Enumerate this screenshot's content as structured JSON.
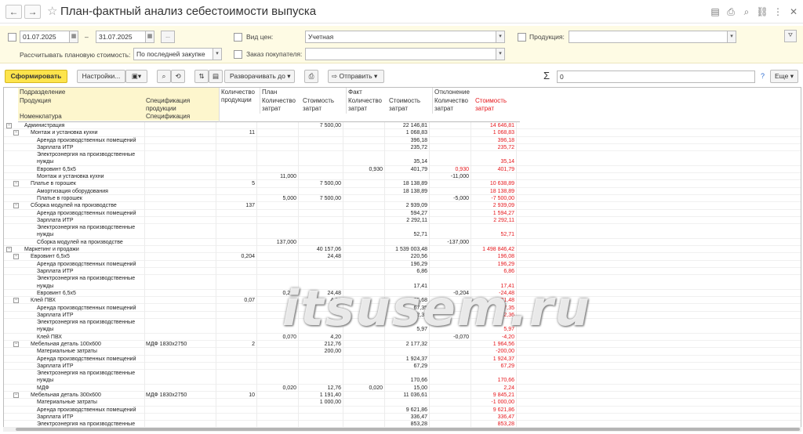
{
  "title": "План-фактный анализ себестоимости выпуска",
  "nav": {
    "back": "←",
    "forward": "→"
  },
  "filter": {
    "date_from": "01.07.2025",
    "date_sep": "–",
    "date_to": "31.07.2025",
    "period_btn": "...",
    "price_type_label": "Вид цен:",
    "price_type_value": "Учетная",
    "product_label": "Продукция:",
    "product_value": "",
    "plan_cost_label": "Рассчитывать плановую стоимость:",
    "plan_cost_value": "По последней закупке",
    "customer_order_label": "Заказ покупателя:",
    "customer_order_value": ""
  },
  "toolbar": {
    "generate": "Сформировать",
    "settings": "Настройки...",
    "expand": "Разворачивать до",
    "send": "Отправить",
    "sum_symbol": "Σ",
    "sum_value": "0",
    "help": "?",
    "more": "Еще"
  },
  "header": {
    "dept": "Подразделение",
    "product": "Продукция",
    "spec": "Спецификация продукции",
    "nomen": "Номенклатура",
    "spec2": "Спецификация",
    "qty_prod": "Количество продукции",
    "plan": "План",
    "fact": "Факт",
    "dev": "Отклонение",
    "qty_cost": "Количество затрат",
    "cost_cost": "Стоимость затрат"
  },
  "rows": [
    {
      "lvl": 0,
      "tog": "⊟",
      "n": "Администрация",
      "spec": "",
      "qp": "",
      "pq": "",
      "pc": "7 500,00",
      "fq": "",
      "fc": "22 146,81",
      "dq": "",
      "dc": "14 646,81"
    },
    {
      "lvl": 1,
      "tog": "⊟",
      "n": "Монтаж и установка кухни",
      "spec": "",
      "qp": "11",
      "pq": "",
      "pc": "",
      "fq": "",
      "fc": "1 068,83",
      "dq": "",
      "dc": "1 068,83"
    },
    {
      "lvl": 2,
      "tog": "",
      "n": "Аренда производственных помещений",
      "spec": "",
      "qp": "",
      "pq": "",
      "pc": "",
      "fq": "",
      "fc": "396,18",
      "dq": "",
      "dc": "396,18"
    },
    {
      "lvl": 2,
      "tog": "",
      "n": "Зарплата ИТР",
      "spec": "",
      "qp": "",
      "pq": "",
      "pc": "",
      "fq": "",
      "fc": "235,72",
      "dq": "",
      "dc": "235,72"
    },
    {
      "lvl": 2,
      "tog": "",
      "n": "Электроэнергия на производственные нужды",
      "spec": "",
      "qp": "",
      "pq": "",
      "pc": "",
      "fq": "",
      "fc": "35,14",
      "dq": "",
      "dc": "35,14",
      "tall": true
    },
    {
      "lvl": 2,
      "tog": "",
      "n": "Евровинт 6,5х5",
      "spec": "",
      "qp": "",
      "pq": "",
      "pc": "",
      "fq": "0,930",
      "fc": "401,79",
      "dq": "0,930",
      "dc": "401,79",
      "dqred": true
    },
    {
      "lvl": 2,
      "tog": "",
      "n": "Монтаж и установка кухни",
      "spec": "",
      "qp": "",
      "pq": "11,000",
      "pc": "",
      "fq": "",
      "fc": "",
      "dq": "-11,000",
      "dc": ""
    },
    {
      "lvl": 1,
      "tog": "⊟",
      "n": "Платье в горошек",
      "spec": "",
      "qp": "5",
      "pq": "",
      "pc": "7 500,00",
      "fq": "",
      "fc": "18 138,89",
      "dq": "",
      "dc": "10 638,89"
    },
    {
      "lvl": 2,
      "tog": "",
      "n": "Амортизация оборудования",
      "spec": "",
      "qp": "",
      "pq": "",
      "pc": "",
      "fq": "",
      "fc": "18 138,89",
      "dq": "",
      "dc": "18 138,89"
    },
    {
      "lvl": 2,
      "tog": "",
      "n": "Платье в горошек",
      "spec": "",
      "qp": "",
      "pq": "5,000",
      "pc": "7 500,00",
      "fq": "",
      "fc": "",
      "dq": "-5,000",
      "dc": "-7 500,00"
    },
    {
      "lvl": 1,
      "tog": "⊟",
      "n": "Сборка модулей на производстве",
      "spec": "",
      "qp": "137",
      "pq": "",
      "pc": "",
      "fq": "",
      "fc": "2 939,09",
      "dq": "",
      "dc": "2 939,09"
    },
    {
      "lvl": 2,
      "tog": "",
      "n": "Аренда производственных помещений",
      "spec": "",
      "qp": "",
      "pq": "",
      "pc": "",
      "fq": "",
      "fc": "594,27",
      "dq": "",
      "dc": "1 594,27"
    },
    {
      "lvl": 2,
      "tog": "",
      "n": "Зарплата ИТР",
      "spec": "",
      "qp": "",
      "pq": "",
      "pc": "",
      "fq": "",
      "fc": "2 292,11",
      "dq": "",
      "dc": "2 292,11"
    },
    {
      "lvl": 2,
      "tog": "",
      "n": "Электроэнергия на производственные нужды",
      "spec": "",
      "qp": "",
      "pq": "",
      "pc": "",
      "fq": "",
      "fc": "52,71",
      "dq": "",
      "dc": "52,71",
      "tall": true
    },
    {
      "lvl": 2,
      "tog": "",
      "n": "Сборка модулей на производстве",
      "spec": "",
      "qp": "",
      "pq": "137,000",
      "pc": "",
      "fq": "",
      "fc": "",
      "dq": "-137,000",
      "dc": ""
    },
    {
      "lvl": 0,
      "tog": "⊟",
      "n": "Маркетинг и продажи",
      "spec": "",
      "qp": "",
      "pq": "",
      "pc": "40 157,06",
      "fq": "",
      "fc": "1 539 003,48",
      "dq": "",
      "dc": "1 498 846,42"
    },
    {
      "lvl": 1,
      "tog": "⊟",
      "n": "Евровинт 6,5х5",
      "spec": "",
      "qp": "0,204",
      "pq": "",
      "pc": "24,48",
      "fq": "",
      "fc": "220,56",
      "dq": "",
      "dc": "196,08"
    },
    {
      "lvl": 2,
      "tog": "",
      "n": "Аренда производственных помещений",
      "spec": "",
      "qp": "",
      "pq": "",
      "pc": "",
      "fq": "",
      "fc": "196,29",
      "dq": "",
      "dc": "196,29"
    },
    {
      "lvl": 2,
      "tog": "",
      "n": "Зарплата ИТР",
      "spec": "",
      "qp": "",
      "pq": "",
      "pc": "",
      "fq": "",
      "fc": "6,86",
      "dq": "",
      "dc": "6,86"
    },
    {
      "lvl": 2,
      "tog": "",
      "n": "Электроэнергия на производственные нужды",
      "spec": "",
      "qp": "",
      "pq": "",
      "pc": "",
      "fq": "",
      "fc": "17,41",
      "dq": "",
      "dc": "17,41",
      "tall": true
    },
    {
      "lvl": 2,
      "tog": "",
      "n": "Евровинт 6,5х5",
      "spec": "",
      "qp": "",
      "pq": "0,204",
      "pc": "24,48",
      "fq": "",
      "fc": "",
      "dq": "-0,204",
      "dc": "-24,48"
    },
    {
      "lvl": 1,
      "tog": "⊟",
      "n": "Клей ПВХ",
      "spec": "",
      "qp": "0,07",
      "pq": "",
      "pc": "4,20",
      "fq": "",
      "fc": "75,68",
      "dq": "",
      "dc": "71,48"
    },
    {
      "lvl": 2,
      "tog": "",
      "n": "Аренда производственных помещений",
      "spec": "",
      "qp": "",
      "pq": "",
      "pc": "",
      "fq": "",
      "fc": "67,35",
      "dq": "",
      "dc": "67,35"
    },
    {
      "lvl": 2,
      "tog": "",
      "n": "Зарплата ИТР",
      "spec": "",
      "qp": "",
      "pq": "",
      "pc": "",
      "fq": "",
      "fc": "2,36",
      "dq": "",
      "dc": "2,36"
    },
    {
      "lvl": 2,
      "tog": "",
      "n": "Электроэнергия на производственные нужды",
      "spec": "",
      "qp": "",
      "pq": "",
      "pc": "",
      "fq": "",
      "fc": "5,97",
      "dq": "",
      "dc": "5,97",
      "tall": true
    },
    {
      "lvl": 2,
      "tog": "",
      "n": "Клей ПВХ",
      "spec": "",
      "qp": "",
      "pq": "0,070",
      "pc": "4,20",
      "fq": "",
      "fc": "",
      "dq": "-0,070",
      "dc": "-4,20"
    },
    {
      "lvl": 1,
      "tog": "⊟",
      "n": "Мебельная деталь 100х600",
      "spec": "МДФ 1830х2750",
      "qp": "2",
      "pq": "",
      "pc": "212,76",
      "fq": "",
      "fc": "2 177,32",
      "dq": "",
      "dc": "1 964,56"
    },
    {
      "lvl": 2,
      "tog": "",
      "n": "Материальные затраты",
      "spec": "",
      "qp": "",
      "pq": "",
      "pc": "200,00",
      "fq": "",
      "fc": "",
      "dq": "",
      "dc": "-200,00"
    },
    {
      "lvl": 2,
      "tog": "",
      "n": "Аренда производственных помещений",
      "spec": "",
      "qp": "",
      "pq": "",
      "pc": "",
      "fq": "",
      "fc": "1 924,37",
      "dq": "",
      "dc": "1 924,37"
    },
    {
      "lvl": 2,
      "tog": "",
      "n": "Зарплата ИТР",
      "spec": "",
      "qp": "",
      "pq": "",
      "pc": "",
      "fq": "",
      "fc": "67,29",
      "dq": "",
      "dc": "67,29"
    },
    {
      "lvl": 2,
      "tog": "",
      "n": "Электроэнергия на производственные нужды",
      "spec": "",
      "qp": "",
      "pq": "",
      "pc": "",
      "fq": "",
      "fc": "170,66",
      "dq": "",
      "dc": "170,66",
      "tall": true
    },
    {
      "lvl": 2,
      "tog": "",
      "n": "МДФ",
      "spec": "",
      "qp": "",
      "pq": "0,020",
      "pc": "12,76",
      "fq": "0,020",
      "fc": "15,00",
      "dq": "",
      "dc": "2,24"
    },
    {
      "lvl": 1,
      "tog": "⊟",
      "n": "Мебельная деталь 300х600",
      "spec": "МДФ 1830х2750",
      "qp": "10",
      "pq": "",
      "pc": "1 191,40",
      "fq": "",
      "fc": "11 036,61",
      "dq": "",
      "dc": "9 845,21"
    },
    {
      "lvl": 2,
      "tog": "",
      "n": "Материальные затраты",
      "spec": "",
      "qp": "",
      "pq": "",
      "pc": "1 000,00",
      "fq": "",
      "fc": "",
      "dq": "",
      "dc": "-1 000,00"
    },
    {
      "lvl": 2,
      "tog": "",
      "n": "Аренда производственных помещений",
      "spec": "",
      "qp": "",
      "pq": "",
      "pc": "",
      "fq": "",
      "fc": "9 621,86",
      "dq": "",
      "dc": "9 621,86"
    },
    {
      "lvl": 2,
      "tog": "",
      "n": "Зарплата ИТР",
      "spec": "",
      "qp": "",
      "pq": "",
      "pc": "",
      "fq": "",
      "fc": "336,47",
      "dq": "",
      "dc": "336,47"
    },
    {
      "lvl": 2,
      "tog": "",
      "n": "Электроэнергия на производственные",
      "spec": "",
      "qp": "",
      "pq": "",
      "pc": "",
      "fq": "",
      "fc": "853,28",
      "dq": "",
      "dc": "853,28"
    }
  ],
  "watermark": "itsusem.ru",
  "colors": {
    "accent": "#fde44c",
    "negative": "#e5161b",
    "header_bg": "#fdf6cd",
    "filter_bg": "#fefbe4"
  }
}
